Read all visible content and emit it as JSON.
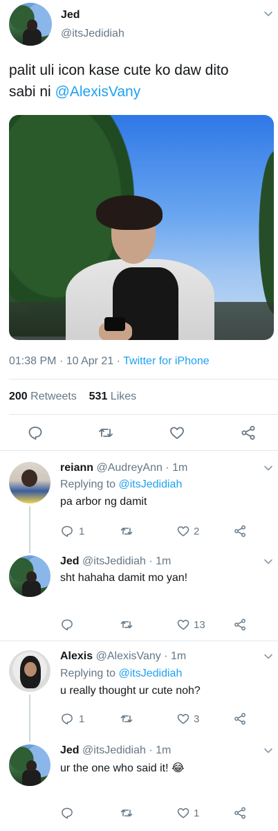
{
  "main_tweet": {
    "author_name": "Jed",
    "author_handle": "@itsJedidiah",
    "text_part1": "palit uli icon kase cute ko daw dito",
    "text_part2": "sabi ni ",
    "mention": "@AlexisVany",
    "time": "01:38 PM",
    "sep1": "·",
    "date": "10 Apr 21",
    "sep2": "·",
    "source": "Twitter for iPhone",
    "retweets_count": "200",
    "retweets_label": "Retweets",
    "likes_count": "531",
    "likes_label": "Likes",
    "actions": [
      "reply-icon",
      "retweet-icon",
      "like-icon",
      "share-icon"
    ]
  },
  "replies": [
    {
      "name": "reiann",
      "handle": "@AudreyAnn",
      "sep": "·",
      "time": "1m",
      "replying_label": "Replying to ",
      "replying_handle": "@itsJedidiah",
      "text": "pa arbor ng damit",
      "reply_count": "1",
      "retweet_count": "",
      "like_count": "2"
    },
    {
      "name": "Jed",
      "handle": "@itsJedidiah",
      "sep": "·",
      "time": "1m",
      "text": "sht hahaha damit mo yan!",
      "reply_count": "",
      "retweet_count": "",
      "like_count": "13"
    },
    {
      "name": "Alexis",
      "handle": "@AlexisVany",
      "sep": "·",
      "time": "1m",
      "replying_label": "Replying to ",
      "replying_handle": "@itsJedidiah",
      "text": "u really thought ur cute noh?",
      "reply_count": "1",
      "retweet_count": "",
      "like_count": "3"
    },
    {
      "name": "Jed",
      "handle": "@itsJedidiah",
      "sep": "·",
      "time": "1m",
      "text": "ur the one who said it! 😂",
      "reply_count": "",
      "retweet_count": "",
      "like_count": "1"
    }
  ],
  "colors": {
    "accent": "#1da1f2",
    "text": "#14171a",
    "secondary": "#657786",
    "divider": "#e1e8ed"
  }
}
